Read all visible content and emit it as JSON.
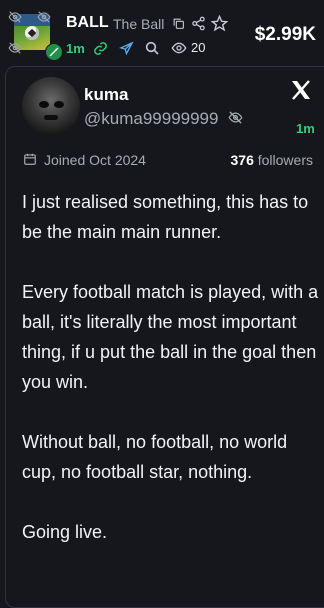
{
  "token": {
    "ticker": "BALL",
    "name": "The Ball",
    "age": "1m",
    "views": "20",
    "market_cap": "$2.99K"
  },
  "tweet": {
    "display_name": "kuma",
    "handle": "@kuma99999999",
    "posted_age": "1m",
    "joined": "Joined Oct 2024",
    "followers_count": "376",
    "followers_label": "followers",
    "text": "I just realised something, this has to be the main main runner.\n\nEvery football match is played, with a ball, it's literally the most important thing, if u put the ball in the goal then you win.\n\nWithout ball, no football, no world cup, no football star, nothing.\n\nGoing live."
  },
  "colors": {
    "background": "#15171c",
    "accent_green": "#2fd07a",
    "muted": "#a6abb6"
  },
  "icons": [
    "eye-off-icon",
    "copy-icon",
    "share-icon",
    "star-icon",
    "link-icon",
    "telegram-icon",
    "search-icon",
    "eye-icon",
    "x-logo-icon",
    "calendar-icon"
  ]
}
